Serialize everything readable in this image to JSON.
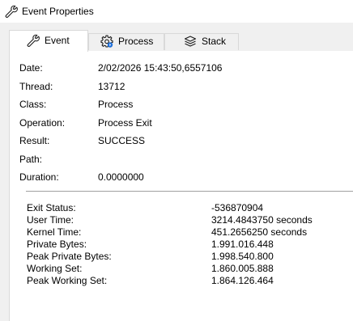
{
  "window": {
    "title": "Event Properties",
    "icon": "wrench-icon"
  },
  "tabs": [
    {
      "label": "Event",
      "icon": "wrench-icon",
      "active": true
    },
    {
      "label": "Process",
      "icon": "gear-icon",
      "active": false
    },
    {
      "label": "Stack",
      "icon": "stack-layers-icon",
      "active": false
    }
  ],
  "event": {
    "fields": [
      {
        "label": "Date:",
        "value": "2/02/2026 15:43:50,6557106"
      },
      {
        "label": "Thread:",
        "value": "13712"
      },
      {
        "label": "Class:",
        "value": "Process"
      },
      {
        "label": "Operation:",
        "value": "Process Exit"
      },
      {
        "label": "Result:",
        "value": "SUCCESS"
      },
      {
        "label": "Path:",
        "value": ""
      },
      {
        "label": "Duration:",
        "value": "0.0000000"
      }
    ],
    "details": [
      {
        "label": "Exit Status:",
        "value": "-536870904"
      },
      {
        "label": "User Time:",
        "value": "3214.4843750 seconds"
      },
      {
        "label": "Kernel Time:",
        "value": "451.2656250 seconds"
      },
      {
        "label": "Private Bytes:",
        "value": "1.991.016.448"
      },
      {
        "label": "Peak Private Bytes:",
        "value": "1.998.540.800"
      },
      {
        "label": "Working Set:",
        "value": "1.860.005.888"
      },
      {
        "label": "Peak Working Set:",
        "value": "1.864.126.464"
      }
    ]
  }
}
